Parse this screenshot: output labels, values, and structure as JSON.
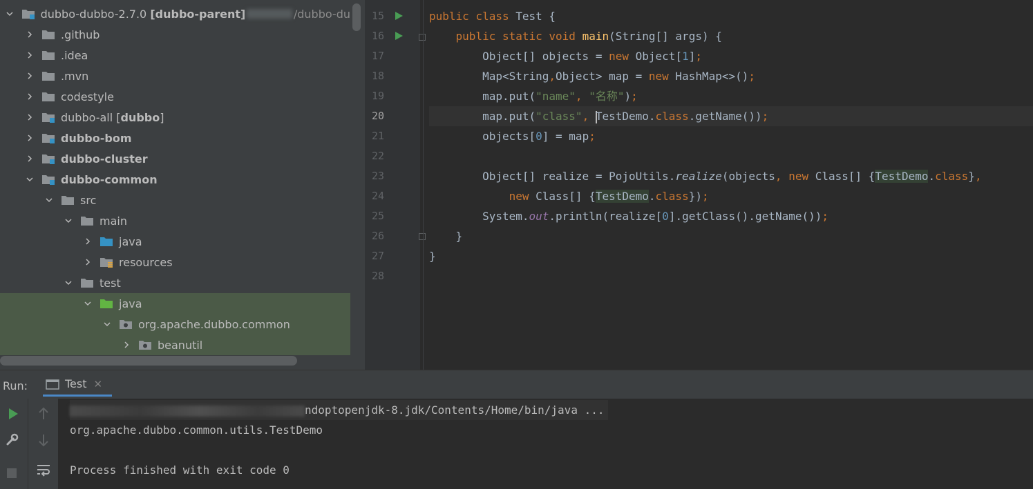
{
  "project_tree": {
    "root": {
      "name": "dubbo-dubbo-2.7.0",
      "module": "[dubbo-parent]",
      "path": "/dubbo-du"
    },
    "items": [
      {
        "label": "dubbo-dubbo-2.7.0",
        "icon": "module-folder-icon"
      },
      {
        "label": ".github",
        "icon": "folder-icon"
      },
      {
        "label": ".idea",
        "icon": "folder-icon"
      },
      {
        "label": ".mvn",
        "icon": "folder-icon"
      },
      {
        "label": "codestyle",
        "icon": "folder-icon"
      },
      {
        "label": "dubbo-all",
        "extra": "dubbo",
        "icon": "module-folder-icon"
      },
      {
        "label": "dubbo-bom",
        "icon": "module-folder-icon"
      },
      {
        "label": "dubbo-cluster",
        "icon": "module-folder-icon"
      },
      {
        "label": "dubbo-common",
        "icon": "module-folder-icon"
      },
      {
        "label": "src",
        "icon": "folder-icon"
      },
      {
        "label": "main",
        "icon": "folder-icon"
      },
      {
        "label": "java",
        "icon": "source-folder-icon"
      },
      {
        "label": "resources",
        "icon": "resources-folder-icon"
      },
      {
        "label": "test",
        "icon": "folder-icon"
      },
      {
        "label": "java",
        "icon": "test-source-folder-icon"
      },
      {
        "label": "org.apache.dubbo.common",
        "icon": "package-icon"
      },
      {
        "label": "beanutil",
        "icon": "package-icon"
      }
    ]
  },
  "editor": {
    "line_numbers": [
      "15",
      "16",
      "17",
      "18",
      "19",
      "20",
      "21",
      "22",
      "23",
      "24",
      "25",
      "26",
      "27",
      "28"
    ],
    "current_line": "20"
  },
  "run_panel": {
    "label": "Run:",
    "tab_label": "Test",
    "tab_close": "✕",
    "console": {
      "command_visible": "ndoptopenjdk-8.jdk/Contents/Home/bin/java ...",
      "output": "org.apache.dubbo.common.utils.TestDemo",
      "finished": "Process finished with exit code 0"
    }
  },
  "colors": {
    "keyword": "#cc7832",
    "string": "#6a8759",
    "number": "#6897bb",
    "method_decl": "#ffc66d",
    "run_green": "#499c54",
    "selection": "#4b5a47"
  }
}
